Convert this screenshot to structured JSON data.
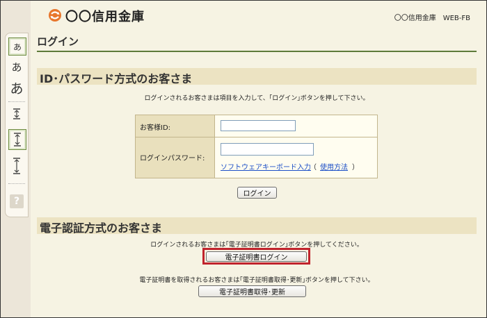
{
  "header": {
    "bank_name": "〇〇信用金庫",
    "system_name": "〇〇信用金庫　WEB-FB"
  },
  "page_title": "ログイン",
  "tools": {
    "font_small": "あ",
    "font_medium": "あ",
    "font_large": "あ",
    "help": "?"
  },
  "password_section": {
    "title": "ID･パスワード方式のお客さま",
    "note": "ログインされるお客さまは項目を入力して、｢ログイン｣ボタンを押して下さい。",
    "customer_id_label": "お客様ID:",
    "customer_id_value": "",
    "password_label": "ログインパスワード:",
    "password_value": "",
    "software_keyboard_link": "ソフトウェアキーボード入力",
    "paren_open": "（",
    "usage_link": "使用方法",
    "paren_close": "）",
    "login_button": "ログイン"
  },
  "certificate_section": {
    "title": "電子認証方式のお客さま",
    "login_note": "ログインされるお客さまは｢電子証明書ログイン｣ボタンを押してください。",
    "cert_login_button": "電子証明書ログイン",
    "acquire_note": "電子証明書を取得されるお客さまは｢電子証明書取得･更新｣ボタンを押して下さい。",
    "cert_acquire_button": "電子証明書取得･更新"
  },
  "colors": {
    "accent_green": "#5d7a3a",
    "section_band": "#ece3c2",
    "highlight_red": "#c0232c",
    "link_blue": "#1c4fc7"
  }
}
